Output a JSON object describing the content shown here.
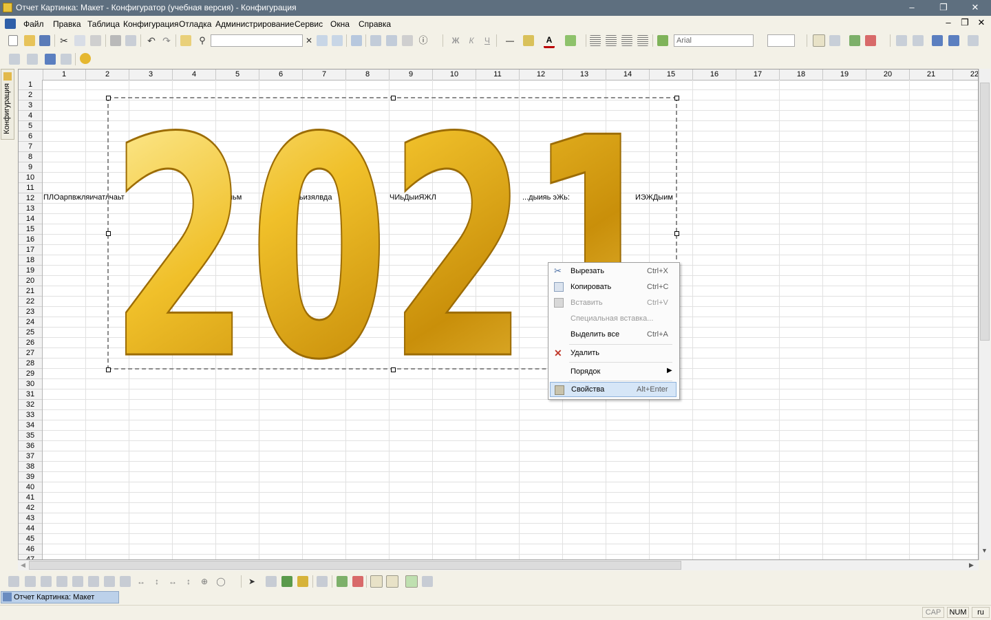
{
  "window": {
    "title": "Отчет Картинка: Макет - Конфигуратор (учебная версия) - Конфигурация"
  },
  "menu": [
    "Файл",
    "Правка",
    "Таблица",
    "Конфигурация",
    "Отладка",
    "Администрирование",
    "Сервис",
    "Окна",
    "Справка"
  ],
  "toolbar": {
    "font_name": "Arial"
  },
  "sidebar": {
    "tab_label": "Конфигурация"
  },
  "sheet": {
    "columns": [
      "1",
      "2",
      "3",
      "4",
      "5",
      "6",
      "7",
      "8",
      "9",
      "10",
      "11",
      "12",
      "13",
      "14",
      "15",
      "16",
      "17",
      "18",
      "19",
      "20",
      "21",
      "22"
    ],
    "rows": [
      "1",
      "2",
      "3",
      "4",
      "5",
      "6",
      "7",
      "8",
      "9",
      "10",
      "11",
      "12",
      "13",
      "14",
      "15",
      "16",
      "17",
      "18",
      "19",
      "20",
      "21",
      "22",
      "23",
      "24",
      "25",
      "26",
      "27",
      "28",
      "29",
      "30",
      "31",
      "32",
      "33",
      "34",
      "35",
      "36",
      "37",
      "38",
      "39",
      "40",
      "41",
      "42",
      "43",
      "44",
      "45",
      "46",
      "47"
    ],
    "row12_texts": [
      "ПЛОарпвжляичатлчаьт",
      "...:эльм",
      "атьизялвда",
      "ЧИьДыиЯЖЛ",
      "...дыияь эЖь:",
      "ИЭЖДыим"
    ],
    "picture_text": "2021"
  },
  "context_menu": {
    "items": [
      {
        "label": "Вырезать",
        "shortcut": "Ctrl+X",
        "icon": "scissors-icon",
        "disabled": false
      },
      {
        "label": "Копировать",
        "shortcut": "Ctrl+C",
        "icon": "copy-icon",
        "disabled": false
      },
      {
        "label": "Вставить",
        "shortcut": "Ctrl+V",
        "icon": "paste-icon",
        "disabled": true
      },
      {
        "label": "Специальная вставка...",
        "shortcut": "",
        "icon": "",
        "disabled": true
      },
      {
        "label": "Выделить все",
        "shortcut": "Ctrl+A",
        "icon": "",
        "disabled": false
      },
      {
        "label": "Удалить",
        "shortcut": "",
        "icon": "delete-icon",
        "disabled": false
      },
      {
        "label": "Порядок",
        "shortcut": "",
        "icon": "",
        "disabled": false
      },
      {
        "label": "Свойства",
        "shortcut": "Alt+Enter",
        "icon": "properties-icon",
        "disabled": false
      }
    ]
  },
  "taskbar": {
    "active_window": "Отчет Картинка: Макет"
  },
  "statusbar": {
    "caps": "CAP",
    "num": "NUM",
    "lang": "ru"
  },
  "colors": {
    "titlebar": "#5e6f7f",
    "selection": "#d6e6f7",
    "gold": "#e3b21c"
  }
}
